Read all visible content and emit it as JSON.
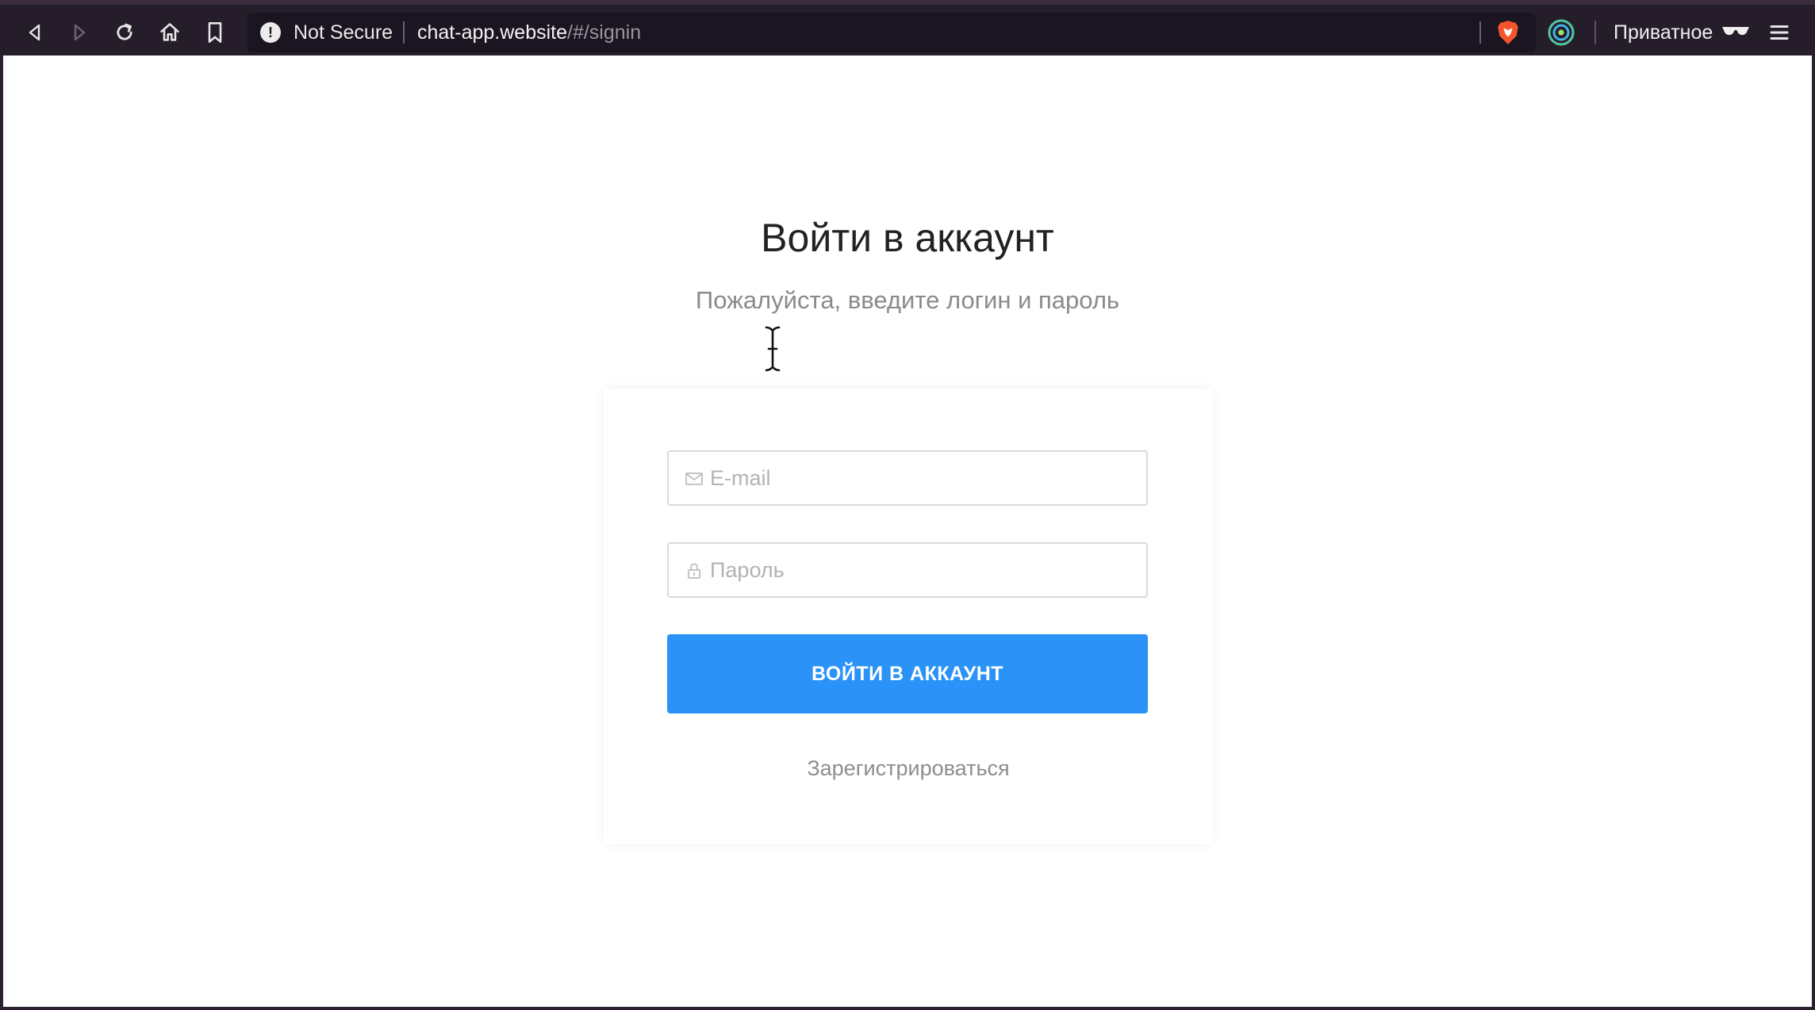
{
  "browser": {
    "url_warning_label": "Not Secure",
    "url_host": "chat-app.website",
    "url_path": "/#/signin",
    "private_label": "Приватное",
    "icons": {
      "back": "back-icon",
      "forward": "forward-icon",
      "reload": "reload-icon",
      "home": "home-icon",
      "bookmark": "bookmark-icon",
      "warning": "warning-icon",
      "brave": "brave-shield-icon",
      "extension": "extension-icon",
      "private": "private-glasses-icon",
      "menu": "menu-icon"
    },
    "colors": {
      "toolbar": "#261d2a",
      "urlbar": "#1a1520",
      "brave": "#f4552d"
    }
  },
  "signin": {
    "title": "Войти в аккаунт",
    "subtitle": "Пожалуйста, введите логин и пароль",
    "email_placeholder": "E-mail",
    "email_value": "",
    "password_placeholder": "Пароль",
    "password_value": "",
    "submit_label": "ВОЙТИ В АККАУНТ",
    "register_label": "Зарегистрироваться",
    "colors": {
      "primary": "#2b93f7",
      "muted_text": "#8d8d8d"
    }
  }
}
